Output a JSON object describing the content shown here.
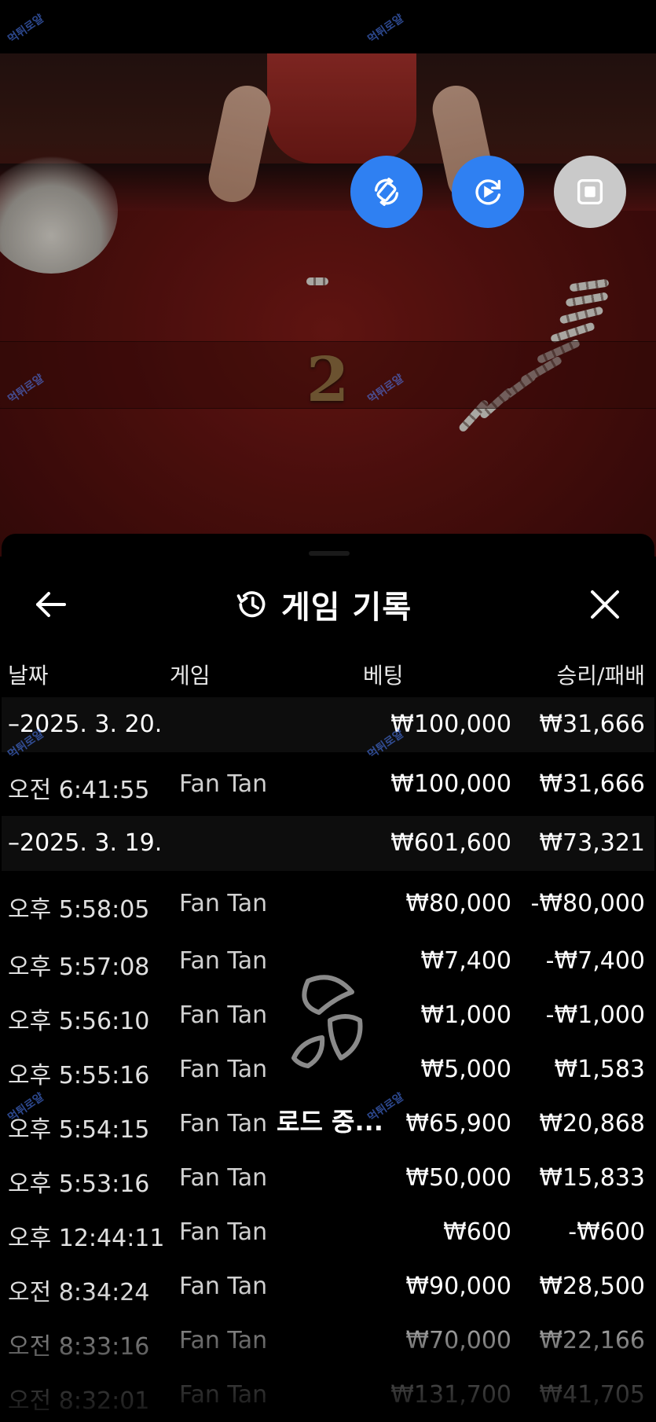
{
  "header": {
    "title": "게임 기록",
    "history_icon": "history-icon",
    "back_icon": "arrow-left-icon",
    "close_icon": "close-icon"
  },
  "video": {
    "round_number": "2",
    "controls": [
      {
        "icon": "rotate-screen-icon",
        "color": "#2f80f2"
      },
      {
        "icon": "replay-video-icon",
        "color": "#2f80f2"
      },
      {
        "icon": "stop-icon",
        "color": "#c9c9c9"
      }
    ]
  },
  "columns": {
    "date": "날짜",
    "game": "게임",
    "bet": "베팅",
    "result": "승리/패배"
  },
  "groups": [
    {
      "date": "–2025. 3. 20.",
      "bet_total": "₩100,000",
      "result_total": "₩31,666",
      "rows": [
        {
          "time": "오전 6:41:55",
          "game": "Fan Tan",
          "bet": "₩100,000",
          "result": "₩31,666"
        }
      ]
    },
    {
      "date": "–2025. 3. 19.",
      "bet_total": "₩601,600",
      "result_total": "₩73,321",
      "rows": [
        {
          "time": "오후 5:58:05",
          "game": "Fan Tan",
          "bet": "₩80,000",
          "result": "-₩80,000"
        },
        {
          "time": "오후 5:57:08",
          "game": "Fan Tan",
          "bet": "₩7,400",
          "result": "-₩7,400"
        },
        {
          "time": "오후 5:56:10",
          "game": "Fan Tan",
          "bet": "₩1,000",
          "result": "-₩1,000"
        },
        {
          "time": "오후 5:55:16",
          "game": "Fan Tan",
          "bet": "₩5,000",
          "result": "₩1,583"
        },
        {
          "time": "오후 5:54:15",
          "game": "Fan Tan",
          "bet": "₩65,900",
          "result": "₩20,868"
        },
        {
          "time": "오후 5:53:16",
          "game": "Fan Tan",
          "bet": "₩50,000",
          "result": "₩15,833"
        },
        {
          "time": "오후 12:44:11",
          "game": "Fan Tan",
          "bet": "₩600",
          "result": "-₩600"
        },
        {
          "time": "오전 8:34:24",
          "game": "Fan Tan",
          "bet": "₩90,000",
          "result": "₩28,500"
        },
        {
          "time": "오전 8:33:16",
          "game": "Fan Tan",
          "bet": "₩70,000",
          "result": "₩22,166"
        },
        {
          "time": "오전 8:32:01",
          "game": "Fan Tan",
          "bet": "₩131,700",
          "result": "₩41,705"
        }
      ]
    }
  ],
  "loading": {
    "text": "로드 중...",
    "icon": "loading-spinner-icon"
  },
  "watermark_text": "먹튀로얄",
  "colors": {
    "accent_blue": "#2f80f2",
    "panel_bg": "#000000",
    "date_row_bg": "#0d0d0d"
  }
}
